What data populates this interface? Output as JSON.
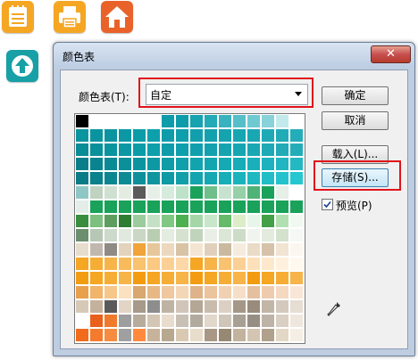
{
  "desktop": {
    "icons": [
      {
        "name": "notes-icon",
        "color": "#f5a623"
      },
      {
        "name": "print-icon",
        "color": "#f5a623"
      },
      {
        "name": "home-icon",
        "color": "#e8622a"
      },
      {
        "name": "upload-icon",
        "color": "#17a0a6"
      }
    ]
  },
  "dialog": {
    "title": "颜色表",
    "close_glyph": "✕",
    "color_table_label": "颜色表(T):",
    "color_table_value": "自定",
    "buttons": {
      "ok": "确定",
      "cancel": "取消",
      "load": "载入(L)...",
      "save": "存储(S)..."
    },
    "preview": {
      "label": "预览(P)",
      "checked": true
    },
    "highlight_color": "#e0141b",
    "palette": [
      [
        "#000000",
        "#ffffff",
        "#ffffff",
        "#ffffff",
        "#ffffff",
        "#ffffff",
        "#0e9cab",
        "#0e9cab",
        "#17a2b0",
        "#23aab7",
        "#39b2bf",
        "#55bec9",
        "#6fc9d1",
        "#88d2d9",
        "#c2e9ec",
        "#ffffff"
      ],
      [
        "#0a949f",
        "#0a949f",
        "#0a949f",
        "#0b98a4",
        "#0c9ca8",
        "#0d9fab",
        "#0e9cab",
        "#0f9eac",
        "#119fad",
        "#13a1af",
        "#15a3b0",
        "#17a5b2",
        "#1aa7b4",
        "#1da9b5",
        "#20abb7",
        "#24adb9"
      ],
      [
        "#088c96",
        "#09909a",
        "#0a949f",
        "#0b98a4",
        "#0c9ca8",
        "#0d9fab",
        "#0e9cab",
        "#0f9eac",
        "#119fad",
        "#13a1af",
        "#15a3b0",
        "#17a5b2",
        "#1aa7b4",
        "#1da9b5",
        "#20abb7",
        "#24adb9"
      ],
      [
        "#087f88",
        "#09848e",
        "#0a8a94",
        "#0b8f99",
        "#0c949e",
        "#0d98a3",
        "#0e9ca7",
        "#0fa0ab",
        "#11a3ae",
        "#13a6b1",
        "#15a9b4",
        "#17acb7",
        "#1aafba",
        "#1db2bd",
        "#20b5c0",
        "#24b8c3"
      ],
      [
        "#0a7c86",
        "#0b818b",
        "#0c8690",
        "#0d8b95",
        "#0e909a",
        "#0f959f",
        "#109aa4",
        "#129fa9",
        "#14a4ae",
        "#16a9b3",
        "#18aeb8",
        "#1ab3bd",
        "#1db8c2",
        "#20bdc7",
        "#23c2cc",
        "#27c7d1"
      ],
      [
        "#8ec8c6",
        "#bfd3c0",
        "#cfe0d0",
        "#e4ece2",
        "#5b5b5b",
        "#e8efe9",
        "#d7ebdd",
        "#bde2c9",
        "#1aa25a",
        "#6fbf8a",
        "#c7e3cf",
        "#96d0a8",
        "#4fb277",
        "#1aa25a",
        "#e6efe8",
        "#ffffff"
      ],
      [
        "#e4ede8",
        "#1aa25a",
        "#1aa25a",
        "#1aa25a",
        "#1aa25a",
        "#1aa25a",
        "#1aa25a",
        "#1aa25a",
        "#1aa25a",
        "#1aa25a",
        "#1aa25a",
        "#1aa25a",
        "#1aa25a",
        "#1aa25a",
        "#1aa25a",
        "#1aa25a"
      ],
      [
        "#388e3c",
        "#7cbf7e",
        "#5d9e5f",
        "#2e7d32",
        "#9ccc9d",
        "#c5e1c5",
        "#81c784",
        "#4caf50",
        "#a5d6a7",
        "#c8e6c9",
        "#66bb6a",
        "#dcedc8",
        "#e8f5e9",
        "#43a047",
        "#b2dfb2",
        "#f1f8f1"
      ],
      [
        "#6b8f6e",
        "#b7c7b5",
        "#cdd9cb",
        "#e1e9df",
        "#c9d7c4",
        "#b9ceb1",
        "#e4ece0",
        "#d6e1d0",
        "#c0d4bb",
        "#e9efe6",
        "#dbe6d6",
        "#cddcc7",
        "#f0f4ee",
        "#e2ebde",
        "#d3e1cd",
        "#f5f8f4"
      ],
      [
        "#e8dccd",
        "#c1b8ad",
        "#8f8a84",
        "#e3d2bc",
        "#f0a43a",
        "#e6c79b",
        "#ebd8bf",
        "#d9c3a5",
        "#f3e5d2",
        "#e0d0bb",
        "#cbb99f",
        "#f6ecdd",
        "#e9dbc6",
        "#d5c2a8",
        "#f1e4d3",
        "#fbf6ef"
      ],
      [
        "#f5a623",
        "#f6ad36",
        "#f7b449",
        "#f8bb5c",
        "#f9c26f",
        "#fac982",
        "#fbd095",
        "#fcd7a8",
        "#f5a623",
        "#f7b449",
        "#f9c26f",
        "#fbd095",
        "#fde0b9",
        "#fee8cb",
        "#fef0dc",
        "#fff8ee"
      ],
      [
        "#f39c12",
        "#f5a623",
        "#f6ad36",
        "#f7b449",
        "#f39c12",
        "#f5a623",
        "#f6ad36",
        "#f7b449",
        "#f39c12",
        "#f5a623",
        "#f6ad36",
        "#f7b449",
        "#f39c12",
        "#f5a623",
        "#f6ad36",
        "#f7b449"
      ],
      [
        "#e8a04c",
        "#f0b46a",
        "#f6c68a",
        "#fbe1bf",
        "#d9a770",
        "#e7b886",
        "#efc89f",
        "#f3d6b5",
        "#dfb389",
        "#ebc49d",
        "#f1d1b2",
        "#f6dfc8",
        "#e5c0a0",
        "#eecbae",
        "#f4d8c0",
        "#f9e6d6"
      ],
      [
        "#d7c9b8",
        "#c4b29c",
        "#5a5a5a",
        "#e2d5c5",
        "#a79a8a",
        "#8d8d8d",
        "#bfb3a4",
        "#d0c5b8",
        "#b5a795",
        "#c9bcac",
        "#dbd0c3",
        "#a59787",
        "#9a8c7c",
        "#c2b6a7",
        "#d4c9bc",
        "#e6ddd3"
      ],
      [
        "#ffffff",
        "#e8601c",
        "#ef7a2c",
        "#9e9e9e",
        "#b7ab9c",
        "#d4c6b4",
        "#e8dccd",
        "#c9c0b5",
        "#b3aa9f",
        "#e1d7ca",
        "#cfc5b8",
        "#a9a095",
        "#978e83",
        "#bdb3a7",
        "#d9cfc2",
        "#efe7dd"
      ],
      [
        "#f26a1b",
        "#f47b2d",
        "#f58c40",
        "#a0a0a0",
        "#ff8a3d",
        "#c7b39c",
        "#b8a890",
        "#d9c9b3",
        "#e8dccb",
        "#a89885",
        "#978874",
        "#c2b39f",
        "#d3c5b2",
        "#b0a18d",
        "#e3d7c6",
        "#f5eee4"
      ]
    ]
  }
}
